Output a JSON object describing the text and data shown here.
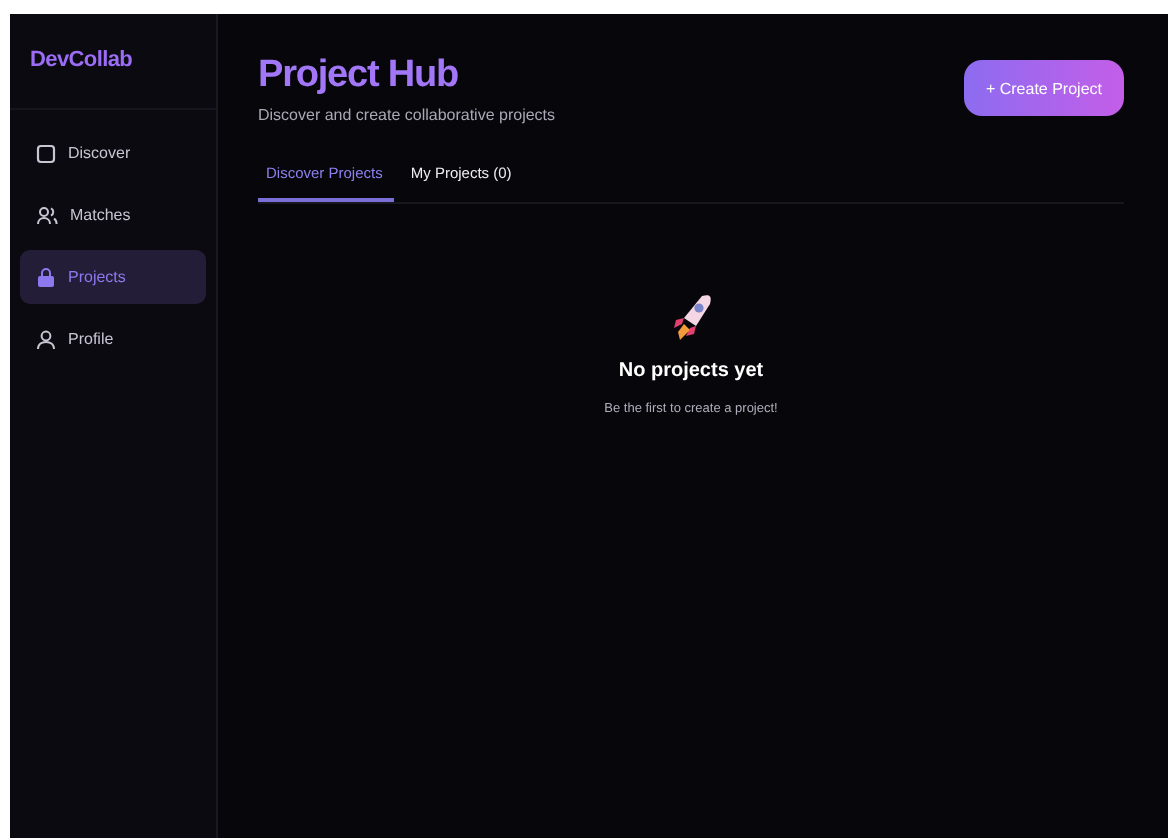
{
  "sidebar": {
    "logo": "DevCollab",
    "items": [
      {
        "label": "Discover",
        "selected": false
      },
      {
        "label": "Matches",
        "selected": false
      },
      {
        "label": "Projects",
        "selected": true
      },
      {
        "label": "Profile",
        "selected": false
      }
    ]
  },
  "header": {
    "title": "Project Hub",
    "subtitle": "Discover and create collaborative projects",
    "button": "+ Create Project"
  },
  "tabs": [
    {
      "label": "Discover Projects",
      "selected": true
    },
    {
      "label": "My Projects (0)",
      "selected": false
    }
  ],
  "empty_state": {
    "title": "No projects yet",
    "message": "Be the first to create a project!"
  }
}
